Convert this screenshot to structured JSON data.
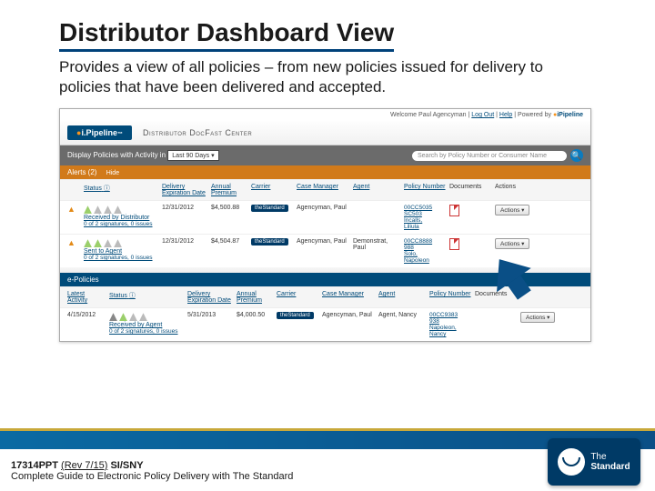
{
  "slide": {
    "title": "Distributor Dashboard View",
    "subtitle": "Provides a view of all policies – from new policies issued for delivery to policies that have been delivered and accepted."
  },
  "app": {
    "brand_pre": "i",
    "brand": "Pipeline",
    "center": "Distributor DocFast Center",
    "welcome": "Welcome Paul Agencyman",
    "logout": "Log Out",
    "help": "Help",
    "powered": "Powered by",
    "powered_brand": "iPipeline"
  },
  "filter": {
    "label": "Display Policies with Activity in",
    "value": "Last 90 Days",
    "search_placeholder": "Search by Policy Number or Consumer Name"
  },
  "alerts": {
    "label": "Alerts (2)",
    "hide": "Hide"
  },
  "columns": {
    "status": "Status",
    "del_exp": "Delivery Expiration Date",
    "premium": "Annual Premium",
    "carrier": "Carrier",
    "case_mgr": "Case Manager",
    "agent": "Agent",
    "policy": "Policy Number",
    "docs": "Documents",
    "actions": "Actions",
    "latest": "Latest Activity"
  },
  "rows": {
    "r1": {
      "status": "Received by Distributor",
      "sig": "0 of 2 signatures, 0 issues",
      "date": "12/31/2012",
      "prem": "$4,500.88",
      "carrier": "theStandard",
      "case_mgr": "Agencyman, Paul",
      "agent": "",
      "p1": "00CC5035",
      "p2": "SC503",
      "p3": "Incalls,",
      "p4": "Liliula",
      "action": "Actions"
    },
    "r2": {
      "status": "Sent to Agent",
      "sig": "0 of 2 signatures, 0 issues",
      "date": "12/31/2012",
      "prem": "$4,504.87",
      "carrier": "theStandard",
      "case_mgr": "Agencyman, Paul",
      "agent": "Demonstrat, Paul",
      "p1": "00CC8888",
      "p2": "988",
      "p3": "Solo,",
      "p4": "Napoleon",
      "action": "Actions"
    }
  },
  "epol": {
    "label": "e-Policies"
  },
  "rows2": {
    "r3": {
      "latest": "4/15/2012",
      "status": "Received by Agent",
      "sig": "0 of 2 signatures, 0 issues",
      "date": "5/31/2013",
      "prem": "$4,000.50",
      "carrier": "theStandard",
      "case_mgr": "Agencyman, Paul",
      "agent": "Agent, Nancy",
      "p1": "00CC9383",
      "p2": "938",
      "p3": "Napoleon,",
      "p4": "Nancy",
      "action": "Actions"
    }
  },
  "footer": {
    "code": "17314PPT",
    "rev": "(Rev 7/15)",
    "sisny": "SI/SNY",
    "guide": "Complete Guide to Electronic Policy Delivery with The Standard",
    "logo_top": "The",
    "logo_bot": "Standard"
  }
}
